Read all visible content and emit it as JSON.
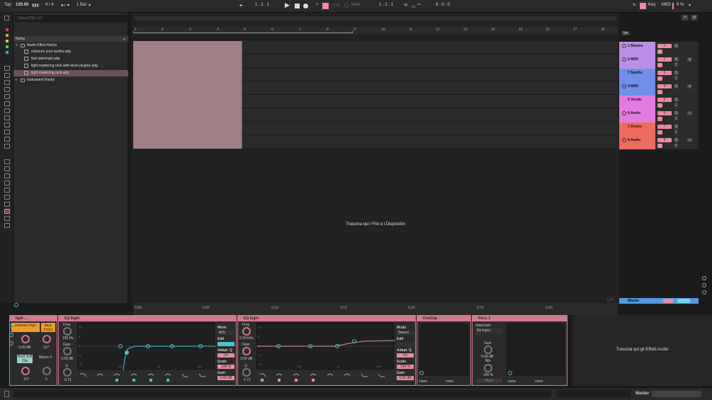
{
  "transport": {
    "tap": "Tap",
    "tempo": "120.00",
    "signature": "4 / 4",
    "quant": "1 Bar",
    "position": "1 .   1 .   1",
    "new": "New",
    "loop_start": "1 .   1 .   1",
    "loop_len": "8 .   0 .   0",
    "key": "Key",
    "midi": "MIDI",
    "cpu": "9 %"
  },
  "browser": {
    "search_placeholder": "Cerca (Ctrl + F)",
    "column": "Nome",
    "items": [
      {
        "label": "Audio Effect Racks",
        "type": "folder"
      },
      {
        "label": "enhance your synths.adg",
        "type": "device"
      },
      {
        "label": "fast sidechain.adg",
        "type": "device"
      },
      {
        "label": "light mastering rack with stock plugins.adg",
        "type": "device"
      },
      {
        "label": "light mastering rack.adg",
        "type": "device",
        "selected": true
      },
      {
        "label": "Instrument Racks",
        "type": "folder"
      }
    ]
  },
  "ruler": [
    "1",
    "2",
    "3",
    "4",
    "5",
    "6",
    "7",
    "8",
    "9",
    "10",
    "11",
    "12",
    "13",
    "14",
    "15",
    "16",
    "17",
    "18"
  ],
  "timeline": [
    "0:00",
    "0:05",
    "0:10",
    "0:15",
    "0:20",
    "0:25",
    "0:30"
  ],
  "arrangement": {
    "drop_text": "Trascina qui i File e i Dispositivi",
    "zoom": "1/4"
  },
  "set_label": "Set",
  "tracks": [
    {
      "name": "1 Basses",
      "num": "1",
      "color": "#b98fe8"
    },
    {
      "name": "2 MIDI",
      "num": "2",
      "color": "#b98fe8"
    },
    {
      "name": "3 Synths",
      "num": "3",
      "color": "#6f8fe8"
    },
    {
      "name": "4 MIDI",
      "num": "4",
      "color": "#6f8fe8"
    },
    {
      "name": "5 Vocals",
      "num": "5",
      "color": "#e27be0"
    },
    {
      "name": "6 Audio",
      "num": "6",
      "color": "#e27be0"
    },
    {
      "name": "7 Drums",
      "num": "7",
      "color": "#ef6b5e"
    },
    {
      "name": "8 Audio",
      "num": "8",
      "color": "#ef6b5e"
    }
  ],
  "master": {
    "name": "Master"
  },
  "rack": {
    "title": "light ...",
    "macro1": "enhance high",
    "macro2": "bass mono",
    "val1": "3.00 dB",
    "val2": "127",
    "macro3": "Hard Soft Clip",
    "macro4": "Macro 4",
    "val3": "127",
    "val4": "0"
  },
  "eq1": {
    "title": "EQ Eight",
    "freq_label": "Freq",
    "freq": "150 Hz",
    "gain_label": "Gain",
    "gain": "0.00 dB",
    "q_label": "Q",
    "q": "0.71",
    "mode_label": "Mode",
    "mode": "M/S",
    "edit": "Edit",
    "adapt": "Adapt. Q",
    "adapt_val": "On",
    "scale": "Scale",
    "scale_val": "100 %",
    "gain2": "Gain",
    "gain2_val": "0.00 dB",
    "ticks_y": [
      "12",
      "6",
      "0",
      "-6",
      "-12"
    ],
    "ticks_x": [
      "100",
      "1k",
      "10k"
    ]
  },
  "eq2": {
    "title": "EQ Eight",
    "freq_label": "Freq",
    "freq": "2.50 kHz",
    "gain_label": "Gain",
    "gain": "3.00 dB",
    "q_label": "Q",
    "q": "0.71",
    "mode_label": "Mode",
    "mode": "Stereo",
    "edit": "Edit",
    "adapt": "Adapt. Q",
    "adapt_val": "On",
    "scale": "Scale",
    "scale_val": "100 %",
    "gain2": "Gain",
    "gain2_val": "0.00 dB",
    "ticks_y": [
      "12",
      "6",
      "0",
      "-6",
      "-12"
    ],
    "ticks_x": [
      "100",
      "1k",
      "10k"
    ]
  },
  "freeclip": {
    "title": "FreeClip",
    "sel1": "none",
    "sel2": "none"
  },
  "prol3": {
    "title": "Pro-L 2",
    "sidechain": "Sidechain",
    "no_input": "No Input",
    "gain": "Gain",
    "gain_val": "0.00 dB",
    "mix": "Mix",
    "mix_val": "100 %",
    "mute": "Mute",
    "sel1": "none",
    "sel2": "none"
  },
  "device_drop": "Trascina qui gli Effetti Audio",
  "status_master": "Master"
}
